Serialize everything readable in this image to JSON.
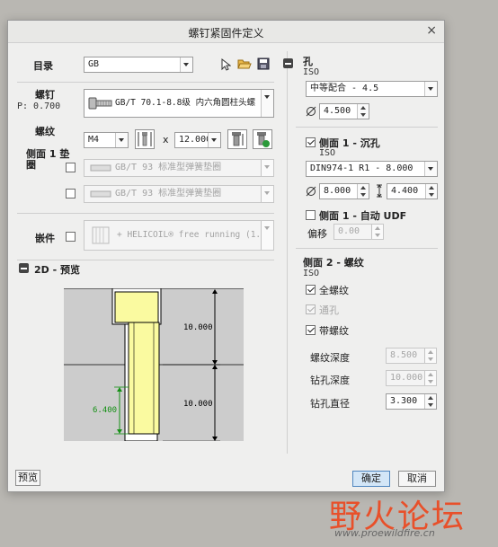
{
  "dialog": {
    "title": "螺钉紧固件定义"
  },
  "left": {
    "catalog_label": "目录",
    "catalog_value": "GB",
    "screw_label": "螺钉",
    "screw_sub": "P: 0.700",
    "screw_value": "GB/T 70.1-8.8级 内六角圆柱头螺",
    "thread_label": "螺纹",
    "thread_size": "M4",
    "x_sign": "x",
    "thread_length": "12.000",
    "washer_label": "侧面 1 垫圈",
    "washer1": "GB/T 93 标准型弹簧垫圈",
    "washer2": "GB/T 93 标准型弹簧垫圈",
    "insert_label": "嵌件",
    "insert_value": "+ HELICOIL® free running (1.0",
    "preview_label": "2D - 预览",
    "preview_button": "预览"
  },
  "preview": {
    "dim_top": "10.000",
    "dim_bottom": "10.000",
    "dim_left": "6.400",
    "colors": {
      "background": "#cccccc",
      "screw": "#fafaa0",
      "outline": "#000000",
      "dimension": "#159015"
    }
  },
  "right": {
    "hole_label": "孔",
    "hole_std": "ISO",
    "fit_value": "中等配合 - 4.5",
    "hole_diameter": "4.500",
    "cb_label": "侧面 1 - 沉孔",
    "cb_std": "ISO",
    "cb_value": "DIN974-1 R1 - 8.000",
    "cb_diameter": "8.000",
    "cb_depth": "4.400",
    "udf_label": "侧面 1 - 自动 UDF",
    "offset_label": "偏移",
    "offset_value": "0.00",
    "thread2_label": "侧面 2 - 螺纹",
    "thread2_std": "ISO",
    "full_thread_label": "全螺纹",
    "through_label": "通孔",
    "tapped_label": "带螺纹",
    "thread_depth_label": "螺纹深度",
    "thread_depth_value": "8.500",
    "drill_depth_label": "钻孔深度",
    "drill_depth_value": "10.000",
    "drill_dia_label": "钻孔直径",
    "drill_dia_value": "3.300"
  },
  "footer": {
    "ok": "确定",
    "cancel": "取消"
  },
  "watermark": {
    "text": "野火论坛",
    "url": "www.proewildfire.cn",
    "color": "#e8502a"
  }
}
